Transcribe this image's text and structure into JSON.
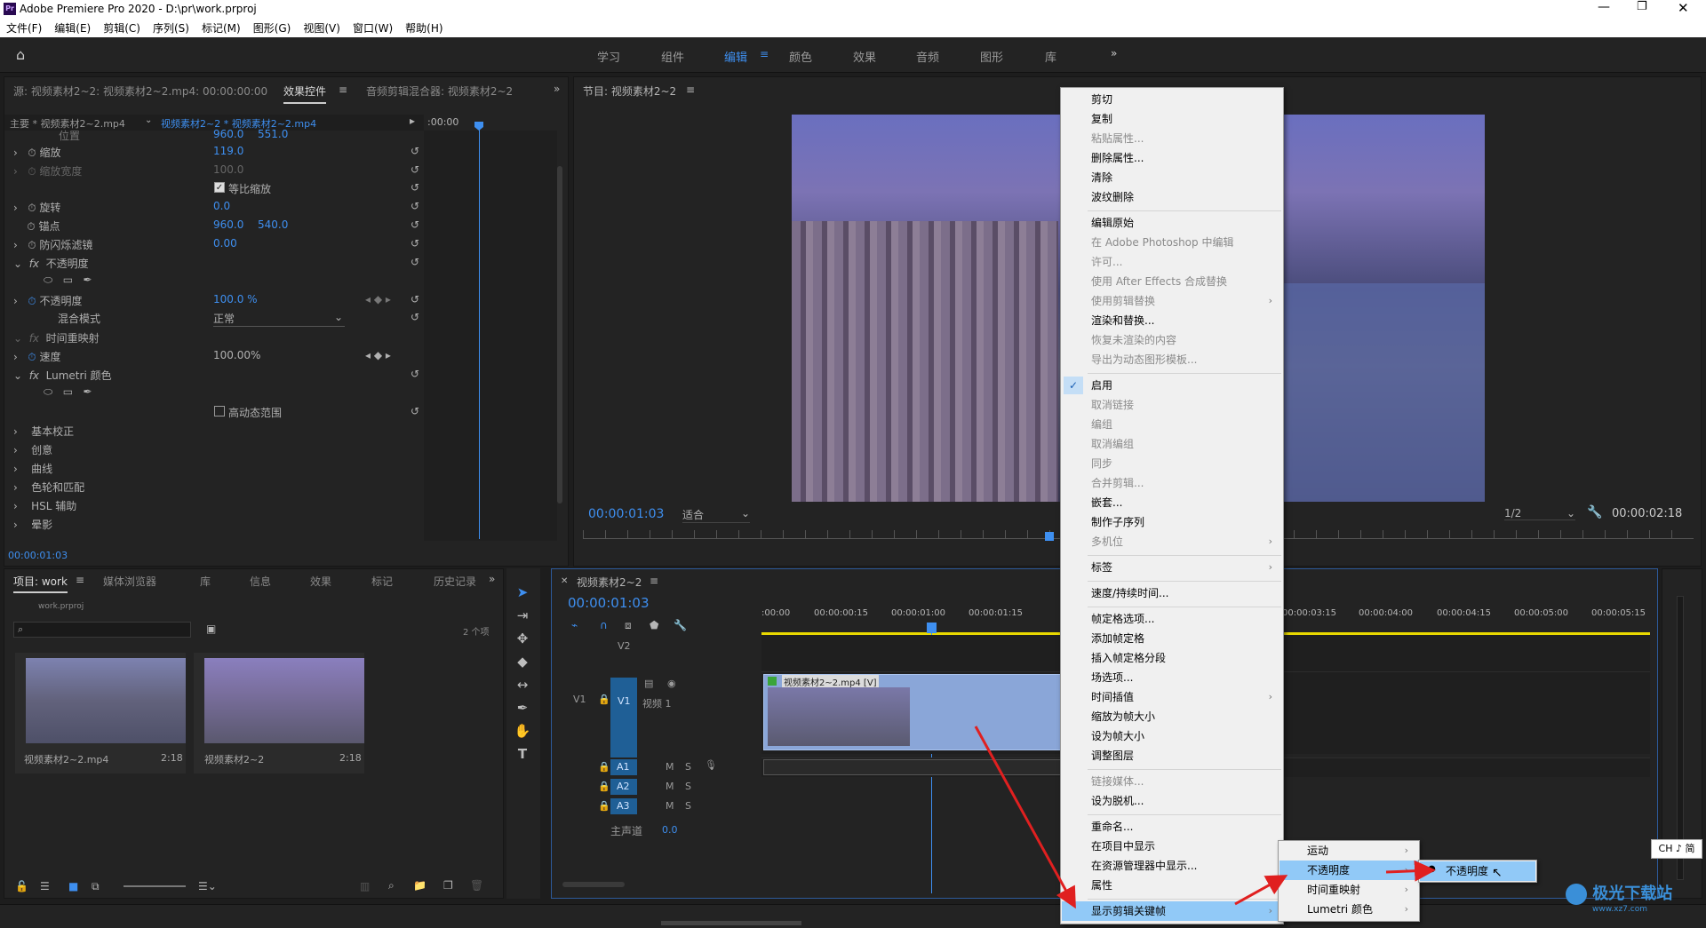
{
  "title": "Adobe Premiere Pro 2020 - D:\\pr\\work.prproj",
  "menu": [
    "文件(F)",
    "编辑(E)",
    "剪辑(C)",
    "序列(S)",
    "标记(M)",
    "图形(G)",
    "视图(V)",
    "窗口(W)",
    "帮助(H)"
  ],
  "workspaces": [
    "学习",
    "组件",
    "编辑",
    "颜色",
    "效果",
    "音频",
    "图形",
    "库"
  ],
  "src_panel": {
    "tab1": "源: 视频素材2~2: 视频素材2~2.mp4: 00:00:00:00",
    "tab2": "效果控件",
    "tab3": "音频剪辑混合器: 视频素材2~2",
    "master": "主要 * 视频素材2~2.mp4",
    "clip": "视频素材2~2 * 视频素材2~2.mp4",
    "ruler": ":00:00",
    "timecode": "00:00:01:03"
  },
  "ec": {
    "position": "位置",
    "pos_v1": "960.0",
    "pos_v2": "551.0",
    "scale": "缩放",
    "scale_v": "119.0",
    "scale_w": "缩放宽度",
    "scale_wv": "100.0",
    "uniform": "等比缩放",
    "rotate": "旋转",
    "rotate_v": "0.0",
    "anchor": "锚点",
    "anchor_v1": "960.0",
    "anchor_v2": "540.0",
    "flicker": "防闪烁滤镜",
    "flicker_v": "0.00",
    "opacity_group": "不透明度",
    "opacity": "不透明度",
    "opacity_v": "100.0 %",
    "blend": "混合模式",
    "blend_v": "正常",
    "timeremap": "时间重映射",
    "speed": "速度",
    "speed_v": "100.00%",
    "lumetri": "Lumetri 颜色",
    "hdr": "高动态范围",
    "basic": "基本校正",
    "creative": "创意",
    "curves": "曲线",
    "wheels": "色轮和匹配",
    "hsl": "HSL 辅助",
    "vignette": "晕影"
  },
  "program": {
    "tab": "节目: 视频素材2~2",
    "timecode": "00:00:01:03",
    "fit": "适合",
    "res": "1/2",
    "duration": "00:00:02:18"
  },
  "project": {
    "tabs": [
      "项目: work",
      "媒体浏览器",
      "库",
      "信息",
      "效果",
      "标记",
      "历史记录"
    ],
    "file": "work.prproj",
    "count": "2 个项",
    "items": [
      {
        "name": "视频素材2~2.mp4",
        "dur": "2:18"
      },
      {
        "name": "视频素材2~2",
        "dur": "2:18"
      }
    ]
  },
  "timeline": {
    "tab": "视频素材2~2",
    "timecode": "00:00:01:03",
    "ruler": [
      ":00:00",
      "00:00:00:15",
      "00:00:01:00",
      "00:00:01:15",
      "00:00:03:15",
      "00:00:04:00",
      "00:00:04:15",
      "00:00:05:00",
      "00:00:05:15"
    ],
    "v2": "V2",
    "v1": "V1",
    "v1label": "视频 1",
    "clip": "视频素材2~2.mp4 [V]",
    "a1": "A1",
    "a2": "A2",
    "a3": "A3",
    "master": "主声道",
    "master_v": "0.0",
    "m": "M",
    "s": "S"
  },
  "ctx": [
    {
      "t": "剪切"
    },
    {
      "t": "复制"
    },
    {
      "t": "粘贴属性...",
      "d": true
    },
    {
      "t": "删除属性..."
    },
    {
      "t": "清除"
    },
    {
      "t": "波纹删除"
    },
    {
      "sep": true
    },
    {
      "t": "编辑原始"
    },
    {
      "t": "在 Adobe Photoshop 中编辑",
      "d": true
    },
    {
      "t": "许可...",
      "d": true
    },
    {
      "t": "使用 After Effects 合成替换",
      "d": true
    },
    {
      "t": "使用剪辑替换",
      "d": true,
      "sub": true
    },
    {
      "t": "渲染和替换..."
    },
    {
      "t": "恢复未渲染的内容",
      "d": true
    },
    {
      "t": "导出为动态图形模板...",
      "d": true
    },
    {
      "sep": true
    },
    {
      "t": "启用",
      "check": true
    },
    {
      "t": "取消链接",
      "d": true
    },
    {
      "t": "编组",
      "d": true
    },
    {
      "t": "取消编组",
      "d": true
    },
    {
      "t": "同步",
      "d": true
    },
    {
      "t": "合并剪辑...",
      "d": true
    },
    {
      "t": "嵌套..."
    },
    {
      "t": "制作子序列"
    },
    {
      "t": "多机位",
      "d": true,
      "sub": true
    },
    {
      "sep": true
    },
    {
      "t": "标签",
      "sub": true
    },
    {
      "sep": true
    },
    {
      "t": "速度/持续时间..."
    },
    {
      "sep": true
    },
    {
      "t": "帧定格选项..."
    },
    {
      "t": "添加帧定格"
    },
    {
      "t": "插入帧定格分段"
    },
    {
      "t": "场选项..."
    },
    {
      "t": "时间插值",
      "sub": true
    },
    {
      "t": "缩放为帧大小"
    },
    {
      "t": "设为帧大小"
    },
    {
      "t": "调整图层"
    },
    {
      "sep": true
    },
    {
      "t": "链接媒体...",
      "d": true
    },
    {
      "t": "设为脱机..."
    },
    {
      "sep": true
    },
    {
      "t": "重命名..."
    },
    {
      "t": "在项目中显示"
    },
    {
      "t": "在资源管理器中显示..."
    },
    {
      "t": "属性"
    },
    {
      "sep": true
    },
    {
      "t": "显示剪辑关键帧",
      "sub": true,
      "hl": true
    }
  ],
  "sub1": [
    "运动",
    "不透明度",
    "时间重映射",
    "Lumetri 颜色"
  ],
  "sub2": "不透明度",
  "ime": "CH ♪ 简",
  "watermark": "极光下载站",
  "watermark_url": "www.xz7.com"
}
